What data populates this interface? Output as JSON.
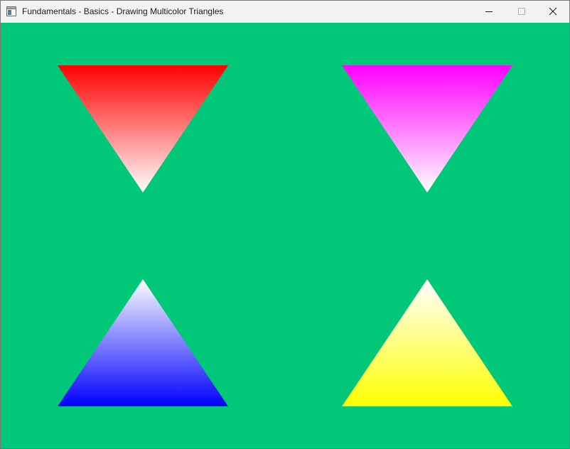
{
  "window": {
    "title": "Fundamentals - Basics - Drawing Multicolor Triangles",
    "controls": {
      "minimize_icon": "minimize-icon",
      "maximize_icon": "maximize-icon",
      "close_icon": "close-icon"
    }
  },
  "canvas": {
    "background_color": "#00c878",
    "triangles": [
      {
        "name": "red",
        "orientation": "down",
        "gradient_from": "#ff0000",
        "gradient_to": "#ffffff"
      },
      {
        "name": "magenta",
        "orientation": "down",
        "gradient_from": "#ff00ff",
        "gradient_to": "#ffffff"
      },
      {
        "name": "blue",
        "orientation": "up",
        "gradient_from": "#ffffff",
        "gradient_to": "#0000ff"
      },
      {
        "name": "yellow",
        "orientation": "up",
        "gradient_from": "#ffffff",
        "gradient_to": "#ffff00"
      }
    ]
  }
}
